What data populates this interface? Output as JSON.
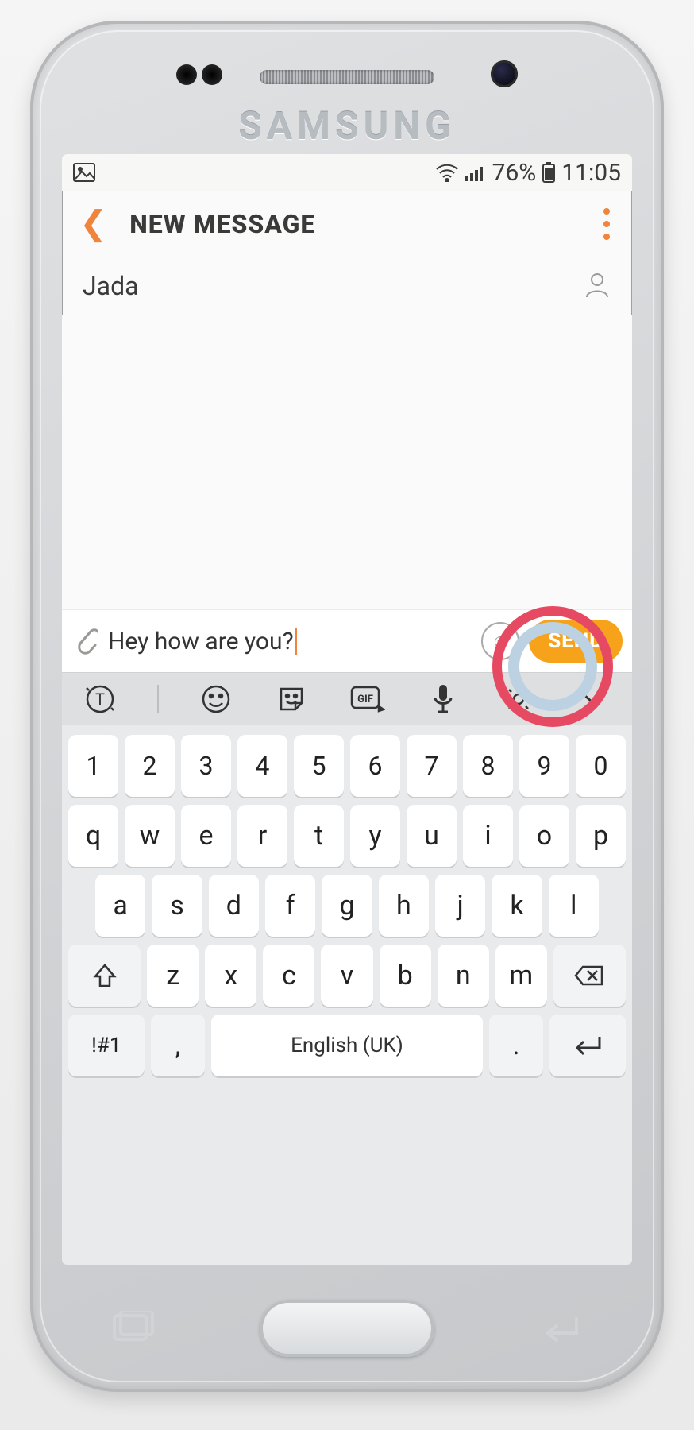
{
  "brand": "SAMSUNG",
  "status": {
    "battery": "76%",
    "time": "11:05"
  },
  "header": {
    "title": "NEW MESSAGE"
  },
  "recipient": {
    "name": "Jada"
  },
  "compose": {
    "text": "Hey how are you?",
    "send": "SEND"
  },
  "keyboard": {
    "row1": [
      "1",
      "2",
      "3",
      "4",
      "5",
      "6",
      "7",
      "8",
      "9",
      "0"
    ],
    "row2": [
      "q",
      "w",
      "e",
      "r",
      "t",
      "y",
      "u",
      "i",
      "o",
      "p"
    ],
    "row3": [
      "a",
      "s",
      "d",
      "f",
      "g",
      "h",
      "j",
      "k",
      "l"
    ],
    "row4": [
      "z",
      "x",
      "c",
      "v",
      "b",
      "n",
      "m"
    ],
    "symKey": "!#1",
    "commaKey": ",",
    "spaceLabel": "English (UK)",
    "periodKey": "."
  }
}
